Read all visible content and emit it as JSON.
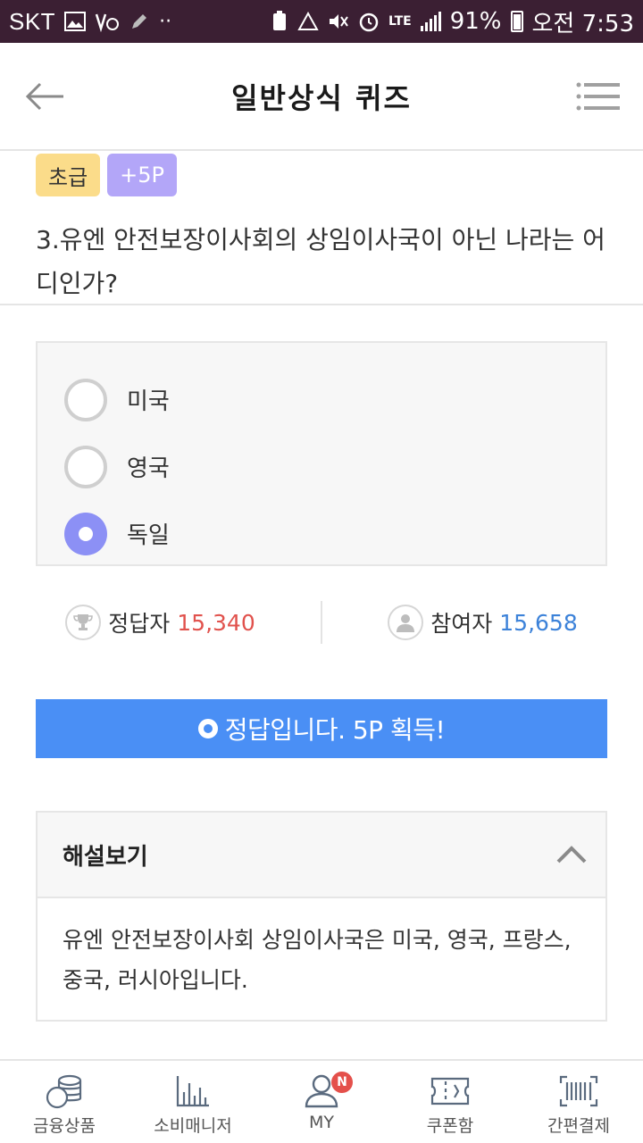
{
  "status_bar": {
    "carrier": "SKT",
    "network": "LTE",
    "battery": "91%",
    "time": "오전 7:53"
  },
  "header": {
    "title": "일반상식 퀴즈",
    "back_icon": "arrow-left-icon",
    "menu_icon": "list-menu-icon"
  },
  "question": {
    "level": "초급",
    "points": "+5P",
    "text": "3.유엔 안전보장이사회의 상임이사국이 아닌 나라는 어디인가?"
  },
  "options": [
    {
      "label": "미국",
      "selected": false
    },
    {
      "label": "영국",
      "selected": false
    },
    {
      "label": "독일",
      "selected": true
    }
  ],
  "stats": {
    "correct_label": "정답자",
    "correct_count": "15,340",
    "participants_label": "참여자",
    "participants_count": "15,658"
  },
  "result": {
    "text": "정답입니다. 5P 획득!",
    "color": "#4a8ff5"
  },
  "explanation": {
    "title": "해설보기",
    "body": "유엔 안전보장이사회 상임이사국은 미국, 영국, 프랑스, 중국, 러시아입니다."
  },
  "bottom_nav": [
    {
      "label": "금융상품",
      "icon": "coins-icon"
    },
    {
      "label": "소비매니저",
      "icon": "bar-chart-icon"
    },
    {
      "label": "MY",
      "icon": "person-icon",
      "badge": "N"
    },
    {
      "label": "쿠폰함",
      "icon": "ticket-icon"
    },
    {
      "label": "간편결제",
      "icon": "barcode-icon"
    }
  ],
  "colors": {
    "status_bar": "#3b1f33",
    "level_badge": "#fbdc8a",
    "points_badge": "#b3a6f8",
    "selected_radio": "#8c90f5",
    "correct_number": "#e1524d",
    "participants_number": "#3c82d9"
  }
}
